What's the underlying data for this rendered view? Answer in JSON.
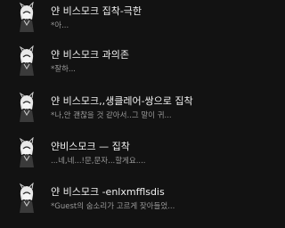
{
  "chats": [
    {
      "title": "얀 비스모크 집착-극한",
      "preview": "*아...",
      "avatar_icon": "character-avatar-icon"
    },
    {
      "title": "얀 비스모크 과의존",
      "preview": "*잘하...",
      "avatar_icon": "character-avatar-icon"
    },
    {
      "title": "얀 비스모크,,생클레어-쌍으로 집착",
      "preview": "*나,안 괜찮을 것 같아서..그 말이 귀...",
      "avatar_icon": "character-avatar-icon"
    },
    {
      "title": "얀비스모크 — 집착",
      "preview": "...네,네...!문,문자...할게요....",
      "avatar_icon": "character-avatar-icon"
    },
    {
      "title": "얀 비스모크 -enlxmfflsdis",
      "preview": "*Guest의 숨소리가 고르게 잦아들었...",
      "avatar_icon": "character-avatar-icon"
    }
  ]
}
